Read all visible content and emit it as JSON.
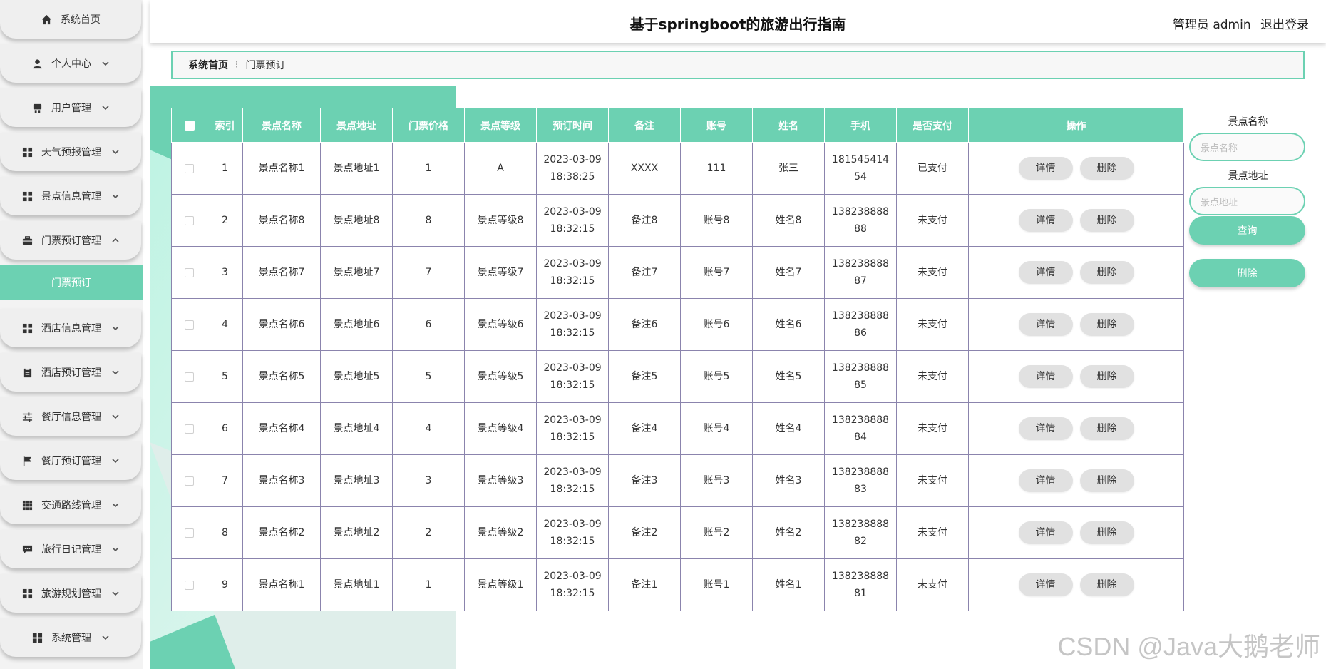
{
  "header": {
    "title": "基于springboot的旅游出行指南",
    "user_label": "管理员 admin",
    "logout_label": "退出登录"
  },
  "sidebar": {
    "items": [
      {
        "label": "系统首页",
        "icon": "home-icon"
      },
      {
        "label": "个人中心",
        "icon": "person-icon"
      },
      {
        "label": "用户管理",
        "icon": "users-icon"
      },
      {
        "label": "天气预报管理",
        "icon": "grid-icon"
      },
      {
        "label": "景点信息管理",
        "icon": "grid-icon"
      },
      {
        "label": "门票预订管理",
        "icon": "briefcase-icon"
      },
      {
        "label": "酒店信息管理",
        "icon": "grid-icon"
      },
      {
        "label": "酒店预订管理",
        "icon": "clipboard-icon"
      },
      {
        "label": "餐厅信息管理",
        "icon": "sliders-icon"
      },
      {
        "label": "餐厅预订管理",
        "icon": "flag-icon"
      },
      {
        "label": "交通路线管理",
        "icon": "apps-icon"
      },
      {
        "label": "旅行日记管理",
        "icon": "chat-icon"
      },
      {
        "label": "旅游规划管理",
        "icon": "grid-icon"
      },
      {
        "label": "系统管理",
        "icon": "grid-icon"
      }
    ],
    "active_sub": "门票预订"
  },
  "breadcrumb": {
    "home": "系统首页",
    "current": "门票预订"
  },
  "table": {
    "headers": [
      "索引",
      "景点名称",
      "景点地址",
      "门票价格",
      "景点等级",
      "预订时间",
      "备注",
      "账号",
      "姓名",
      "手机",
      "是否支付",
      "操作"
    ],
    "detail_label": "详情",
    "delete_label": "删除",
    "rows": [
      {
        "index": "1",
        "name": "景点名称1",
        "address": "景点地址1",
        "price": "1",
        "level": "A",
        "date": "2023-03-09",
        "time": "18:38:25",
        "note": "XXXX",
        "account": "111",
        "person": "张三",
        "phone1": "181545414",
        "phone2": "54",
        "paid": "已支付"
      },
      {
        "index": "2",
        "name": "景点名称8",
        "address": "景点地址8",
        "price": "8",
        "level": "景点等级8",
        "date": "2023-03-09",
        "time": "18:32:15",
        "note": "备注8",
        "account": "账号8",
        "person": "姓名8",
        "phone1": "138238888",
        "phone2": "88",
        "paid": "未支付"
      },
      {
        "index": "3",
        "name": "景点名称7",
        "address": "景点地址7",
        "price": "7",
        "level": "景点等级7",
        "date": "2023-03-09",
        "time": "18:32:15",
        "note": "备注7",
        "account": "账号7",
        "person": "姓名7",
        "phone1": "138238888",
        "phone2": "87",
        "paid": "未支付"
      },
      {
        "index": "4",
        "name": "景点名称6",
        "address": "景点地址6",
        "price": "6",
        "level": "景点等级6",
        "date": "2023-03-09",
        "time": "18:32:15",
        "note": "备注6",
        "account": "账号6",
        "person": "姓名6",
        "phone1": "138238888",
        "phone2": "86",
        "paid": "未支付"
      },
      {
        "index": "5",
        "name": "景点名称5",
        "address": "景点地址5",
        "price": "5",
        "level": "景点等级5",
        "date": "2023-03-09",
        "time": "18:32:15",
        "note": "备注5",
        "account": "账号5",
        "person": "姓名5",
        "phone1": "138238888",
        "phone2": "85",
        "paid": "未支付"
      },
      {
        "index": "6",
        "name": "景点名称4",
        "address": "景点地址4",
        "price": "4",
        "level": "景点等级4",
        "date": "2023-03-09",
        "time": "18:32:15",
        "note": "备注4",
        "account": "账号4",
        "person": "姓名4",
        "phone1": "138238888",
        "phone2": "84",
        "paid": "未支付"
      },
      {
        "index": "7",
        "name": "景点名称3",
        "address": "景点地址3",
        "price": "3",
        "level": "景点等级3",
        "date": "2023-03-09",
        "time": "18:32:15",
        "note": "备注3",
        "account": "账号3",
        "person": "姓名3",
        "phone1": "138238888",
        "phone2": "83",
        "paid": "未支付"
      },
      {
        "index": "8",
        "name": "景点名称2",
        "address": "景点地址2",
        "price": "2",
        "level": "景点等级2",
        "date": "2023-03-09",
        "time": "18:32:15",
        "note": "备注2",
        "account": "账号2",
        "person": "姓名2",
        "phone1": "138238888",
        "phone2": "82",
        "paid": "未支付"
      },
      {
        "index": "9",
        "name": "景点名称1",
        "address": "景点地址1",
        "price": "1",
        "level": "景点等级1",
        "date": "2023-03-09",
        "time": "18:32:15",
        "note": "备注1",
        "account": "账号1",
        "person": "姓名1",
        "phone1": "138238888",
        "phone2": "81",
        "paid": "未支付"
      }
    ]
  },
  "search": {
    "name_label": "景点名称",
    "name_placeholder": "景点名称",
    "address_label": "景点地址",
    "address_placeholder": "景点地址",
    "query_label": "查询",
    "delete_label": "删除"
  },
  "watermark": "CSDN @Java大鹅老师",
  "colors": {
    "accent": "#6cd1b2",
    "row_border": "#8b84ad"
  }
}
